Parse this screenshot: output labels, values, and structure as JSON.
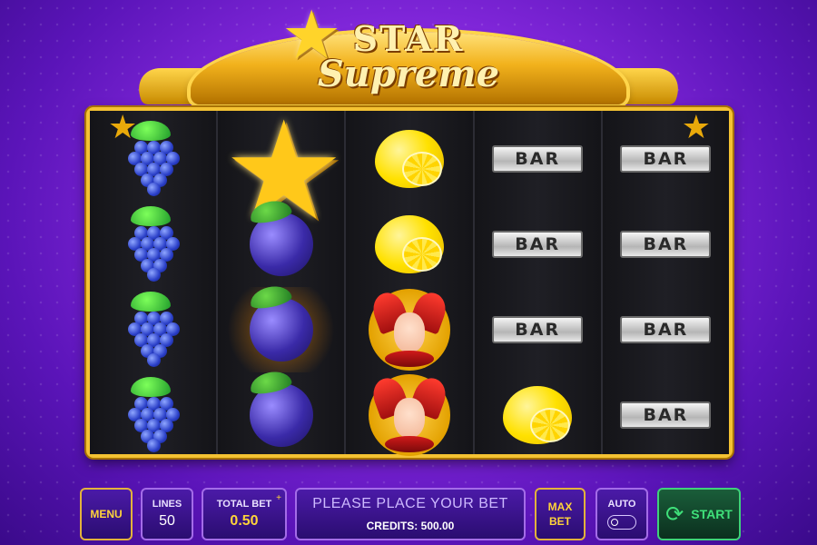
{
  "logo": {
    "line1": "STAR",
    "line2": "Supreme",
    "star_glyph": "★"
  },
  "reels": [
    [
      "grapes",
      "grapes",
      "grapes",
      "grapes"
    ],
    [
      "star",
      "plum",
      "plum-glow",
      "plum"
    ],
    [
      "lemon",
      "lemon",
      "jester",
      "jester"
    ],
    [
      "bar",
      "bar",
      "bar",
      "lemon"
    ],
    [
      "bar",
      "bar",
      "bar",
      "bar"
    ]
  ],
  "bar_text": "BAR",
  "controls": {
    "menu_label": "MENU",
    "lines_label": "LINES",
    "lines_value": "50",
    "total_bet_label": "TOTAL BET",
    "total_bet_value": "0.50",
    "message": "PLEASE PLACE YOUR BET",
    "credits": "CREDITS: 500.00",
    "max_bet_line1": "MAX",
    "max_bet_line2": "BET",
    "auto_label": "AUTO",
    "start_label": "START",
    "start_icon": "⟳",
    "plus_glyph": "+"
  },
  "colors": {
    "accent_gold": "#f4c233",
    "start_green": "#3fe07a",
    "bg_purple": "#8a2be2"
  }
}
